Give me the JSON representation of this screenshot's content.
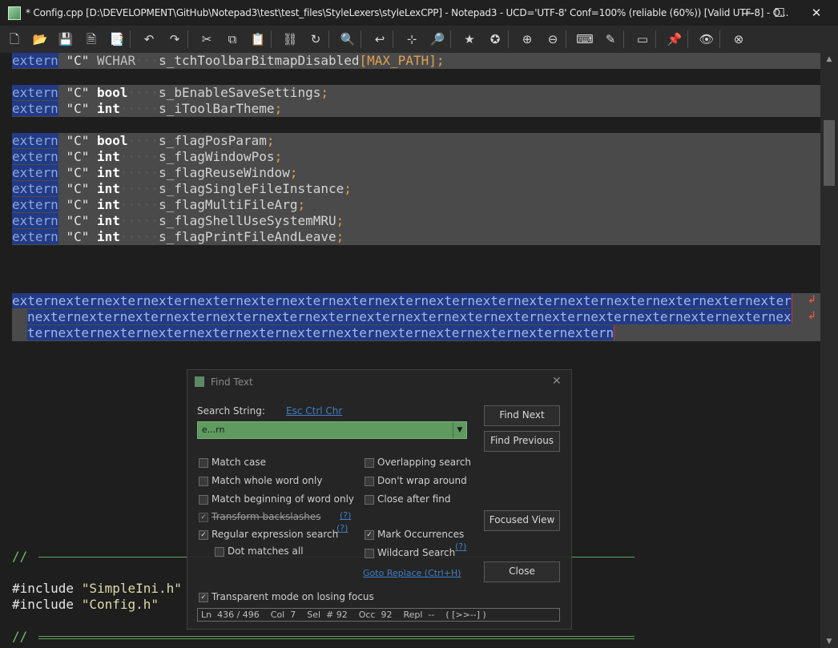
{
  "window": {
    "title": "* Config.cpp [D:\\DEVELOPMENT\\GitHub\\Notepad3\\test\\test_files\\StyleLexers\\styleLexCPP] - Notepad3 - UCD='UTF-8' Conf=100% (reliable (60%)) [Valid UTF-8] - O...",
    "minimize": "—",
    "maximize": "☐",
    "close": "✕"
  },
  "toolbar": {
    "icons": [
      "new-file-icon",
      "open-folder-icon",
      "save-icon",
      "save-as-icon",
      "save-copy-icon",
      "undo-icon",
      "redo-icon",
      "cut-icon",
      "copy-icon",
      "paste-icon",
      "find-icon",
      "replace-icon",
      "find-in-files-icon",
      "word-wrap-icon",
      "zoom-selection-icon",
      "magnifier-icon",
      "bookmark-star-icon",
      "add-favorite-icon",
      "zoom-in-icon",
      "zoom-out-icon",
      "keyboard-icon",
      "pen-ruler-icon",
      "terminal-icon",
      "pin-icon",
      "eye-icon",
      "close-circle-icon"
    ],
    "glyphs": [
      "🗋",
      "📂",
      "💾",
      "🗎",
      "📑",
      "↶",
      "↷",
      "✂",
      "⧉",
      "📋",
      "⛓",
      "↻",
      "🔍",
      "↩",
      "⊹",
      "🔎",
      "★",
      "✪",
      "⊕",
      "⊖",
      "⌨",
      "✎",
      "▭",
      "📌",
      "👁",
      "⊗"
    ]
  },
  "editor": {
    "kw": "extern",
    "str": "\"C\"",
    "rows": [
      {
        "type": "WCHAR",
        "name": "s_tchToolbarBitmapDisabled",
        "suffix": "[MAX_PATH];"
      },
      {
        "type": "bool",
        "name": "s_bEnableSaveSettings",
        "suffix": ";"
      },
      {
        "type": "int",
        "name": "s_iToolBarTheme",
        "suffix": ";"
      },
      {
        "type": "bool",
        "name": "s_flagPosParam",
        "suffix": ";"
      },
      {
        "type": "int",
        "name": "s_flagWindowPos",
        "suffix": ";"
      },
      {
        "type": "int",
        "name": "s_flagReuseWindow",
        "suffix": ";"
      },
      {
        "type": "int",
        "name": "s_flagSingleFileInstance",
        "suffix": ";"
      },
      {
        "type": "int",
        "name": "s_flagMultiFileArg",
        "suffix": ";"
      },
      {
        "type": "int",
        "name": "s_flagShellUseSystemMRU",
        "suffix": ";"
      },
      {
        "type": "int",
        "name": "s_flagPrintFileAndLeave",
        "suffix": ";"
      }
    ],
    "wrap1": "externexternexternexternexternexternexternexternexternexternexternexternexternexternexternexternexter",
    "wrap2": "nexternexternexternexternexternexternexternexternexternexternexternexternexternexternexternexternex",
    "wrap3": "ternexternexternexternexternexternexternexternexternexternexternexternextern",
    "comment1": "//",
    "include1_kw": "#include",
    "include1_file": "\"SimpleIni.h\"",
    "include2_kw": "#include",
    "include2_file": "\"Config.h\"",
    "comment2": "//"
  },
  "dialog": {
    "title": "Find Text",
    "close": "✕",
    "search_label": "Search String:",
    "esc_link": "Esc Ctrl Chr",
    "search_value": "e...rn",
    "find_next": "Find Next",
    "find_previous": "Find Previous",
    "focused_view": "Focused View",
    "close_button": "Close",
    "goto_replace": "Goto Replace (Ctrl+H)",
    "help": "(?)",
    "options_left": [
      {
        "label": "Match case",
        "checked": false
      },
      {
        "label": "Match whole word only",
        "checked": false
      },
      {
        "label": "Match beginning of word only",
        "checked": false
      },
      {
        "label": "Transform backslashes",
        "checked": true
      },
      {
        "label": "Regular expression search",
        "checked": true
      },
      {
        "label": "Dot matches all",
        "checked": false
      }
    ],
    "options_right": [
      {
        "label": "Overlapping search",
        "checked": false
      },
      {
        "label": "Don't wrap around",
        "checked": false
      },
      {
        "label": "Close after find",
        "checked": false
      },
      {
        "label": "Mark Occurrences",
        "checked": true
      },
      {
        "label": "Wildcard Search",
        "checked": false
      }
    ],
    "transparent": {
      "label": "Transparent mode on losing focus",
      "checked": true
    },
    "status": "Ln  436 / 496    Col  7    Sel  # 92    Occ  92    Repl  --    ( [>>--] )"
  }
}
